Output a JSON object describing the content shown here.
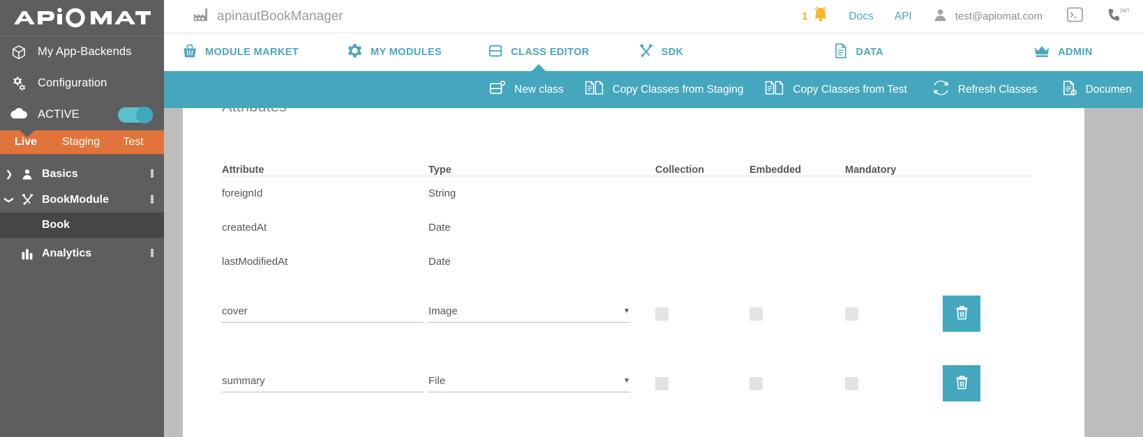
{
  "brand": {
    "logo_text": "APIOMAT",
    "accent": "#44a7bd",
    "orange": "#e2743b",
    "sidebar_bg": "#5e5e5e"
  },
  "sidebar": {
    "items": [
      {
        "label": "My App-Backends",
        "icon": "cube-icon"
      },
      {
        "label": "Configuration",
        "icon": "gears-icon"
      }
    ],
    "status": {
      "label": "ACTIVE",
      "icon": "cloud-icon",
      "toggle_on": true
    },
    "environments": [
      {
        "label": "Live",
        "active": true
      },
      {
        "label": "Staging",
        "active": false
      },
      {
        "label": "Test",
        "active": false
      }
    ],
    "tree": [
      {
        "label": "Basics",
        "icon": "user-icon",
        "expanded": false,
        "chevron": "chevron-right-icon"
      },
      {
        "label": "BookModule",
        "icon": "tools-icon",
        "expanded": true,
        "chevron": "chevron-down-icon"
      },
      {
        "label": "Book",
        "child": true,
        "selected": true
      },
      {
        "label": "Analytics",
        "icon": "chart-icon",
        "expanded": false,
        "chevron": ""
      }
    ]
  },
  "header": {
    "project_name": "apinautBookManager",
    "project_icon": "factory-icon",
    "notification_count": "1",
    "notification_icon": "bell-icon",
    "links": [
      {
        "label": "Docs"
      },
      {
        "label": "API"
      }
    ],
    "user_email": "test@apiomat.com",
    "user_icon": "person-icon",
    "terminal_icon": "terminal-icon",
    "support_icon": "phone-24-7-icon"
  },
  "nav": {
    "tabs": [
      {
        "label": "MODULE MARKET",
        "icon": "basket-icon",
        "active": false
      },
      {
        "label": "MY MODULES",
        "icon": "gear-icon",
        "active": false
      },
      {
        "label": "CLASS EDITOR",
        "icon": "class-icon",
        "active": true
      },
      {
        "label": "SDK",
        "icon": "tools-icon",
        "active": false
      },
      {
        "label": "DATA",
        "icon": "document-icon",
        "active": false
      },
      {
        "label": "ADMIN",
        "icon": "crown-icon",
        "active": false
      }
    ]
  },
  "toolbar": {
    "items": [
      {
        "label": "New class",
        "icon": "new-class-icon"
      },
      {
        "label": "Copy Classes from Staging",
        "icon": "copy-icon"
      },
      {
        "label": "Copy Classes from Test",
        "icon": "copy-icon"
      },
      {
        "label": "Refresh Classes",
        "icon": "refresh-icon"
      },
      {
        "label": "Documen",
        "icon": "documentation-icon"
      }
    ]
  },
  "main": {
    "section_title": "Attributes",
    "columns": [
      {
        "key": "attribute",
        "label": "Attribute"
      },
      {
        "key": "type",
        "label": "Type"
      },
      {
        "key": "collection",
        "label": "Collection"
      },
      {
        "key": "embedded",
        "label": "Embedded"
      },
      {
        "key": "mandatory",
        "label": "Mandatory"
      }
    ],
    "readonly_rows": [
      {
        "attribute": "foreignId",
        "type": "String"
      },
      {
        "attribute": "createdAt",
        "type": "Date"
      },
      {
        "attribute": "lastModifiedAt",
        "type": "Date"
      }
    ],
    "editable_rows": [
      {
        "attribute": "cover",
        "type": "Image",
        "collection": false,
        "embedded": false,
        "mandatory": false,
        "delete_icon": "trash-icon"
      },
      {
        "attribute": "summary",
        "type": "File",
        "collection": false,
        "embedded": false,
        "mandatory": false,
        "delete_icon": "trash-icon"
      }
    ]
  }
}
